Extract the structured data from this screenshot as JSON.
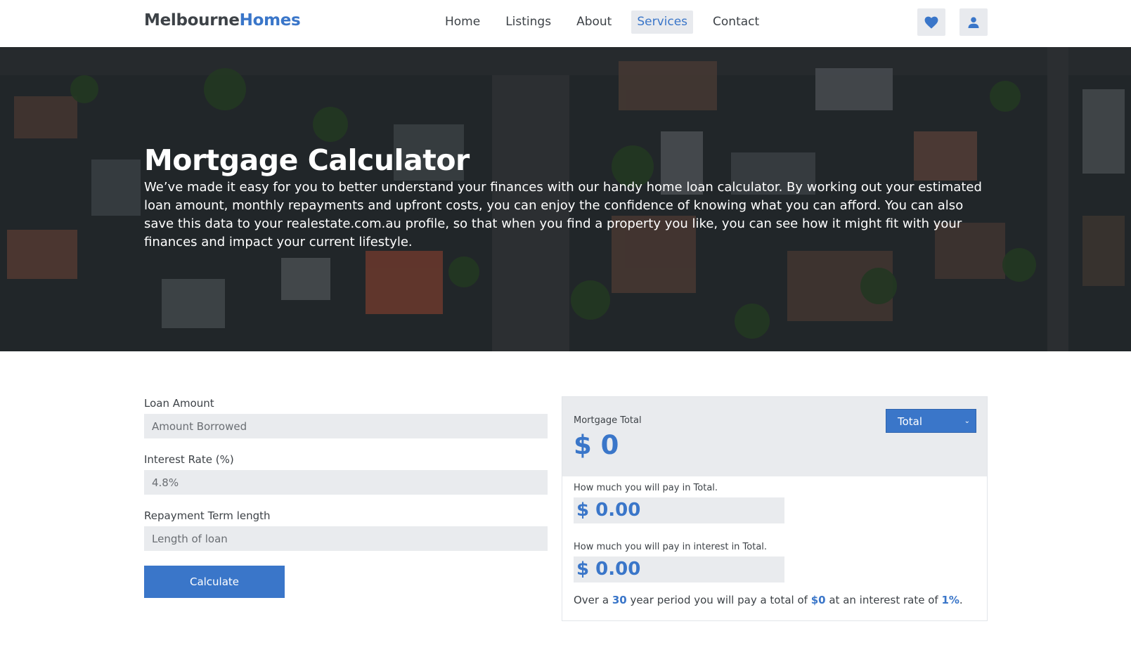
{
  "nav": {
    "brand_part1": "Melbourne",
    "brand_part2": "Homes",
    "links": [
      "Home",
      "Listings",
      "About",
      "Services",
      "Contact"
    ],
    "active_link": "Services",
    "icons": [
      "heart-icon",
      "user-icon"
    ]
  },
  "hero": {
    "title": "Mortgage Calculator",
    "description": "We’ve made it easy for you to better understand your finances with our handy home loan calculator. By working out your estimated loan amount, monthly repayments and upfront costs, you can enjoy the confidence of knowing what you can afford. You can also save this data to your realestate.com.au profile, so that when you find a property you like, you can see how it might fit with your finances and impact your current lifestyle."
  },
  "form": {
    "loan_amount": {
      "label": "Loan Amount",
      "placeholder": "Amount Borrowed",
      "value": ""
    },
    "interest_rate": {
      "label": "Interest Rate (%)",
      "placeholder": "4.8%",
      "value": ""
    },
    "term": {
      "label": "Repayment Term length",
      "placeholder": "Length of loan",
      "value": ""
    },
    "calculate_label": "Calculate"
  },
  "results": {
    "mortgage_total_label": "Mortgage Total",
    "mortgage_total_value": "$ 0",
    "select_value": "Total",
    "total_label": "How much you will pay in Total.",
    "total_value": "$ 0.00",
    "interest_label": "How much you will pay in interest in Total.",
    "interest_value": "$ 0.00",
    "summary": {
      "part1": "Over a ",
      "years": "30",
      "part2": " year period you will pay a total of ",
      "amount": "$0",
      "part3": " at an interest rate of ",
      "rate": "1%",
      "part4": "."
    }
  },
  "colors": {
    "accent": "#3a76c9",
    "field_bg": "#e9ebee",
    "text": "#3d4247"
  }
}
